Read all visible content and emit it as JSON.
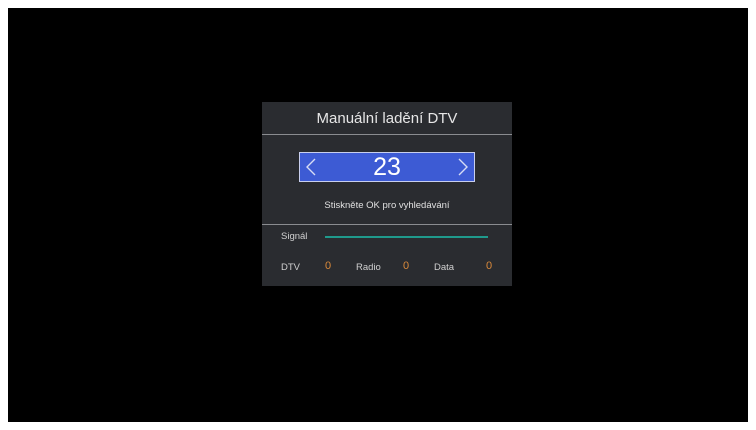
{
  "dialog": {
    "title": "Manuální ladění DTV",
    "channel": "23",
    "left_arrow": "left-chevron-icon",
    "right_arrow": "right-chevron-icon",
    "hint": "Stiskněte OK pro vyhledávání"
  },
  "signal": {
    "label": "Signál",
    "level_fraction": 1.0,
    "color": "#1f9a8c"
  },
  "counts": {
    "dtv_label": "DTV",
    "dtv_value": "0",
    "radio_label": "Radio",
    "radio_value": "0",
    "data_label": "Data",
    "data_value": "0",
    "value_color": "#d9893a"
  },
  "colors": {
    "channel_box": "#3d5bd4",
    "dialog_bg": "#2a2c30",
    "screen_bg": "#000000"
  }
}
